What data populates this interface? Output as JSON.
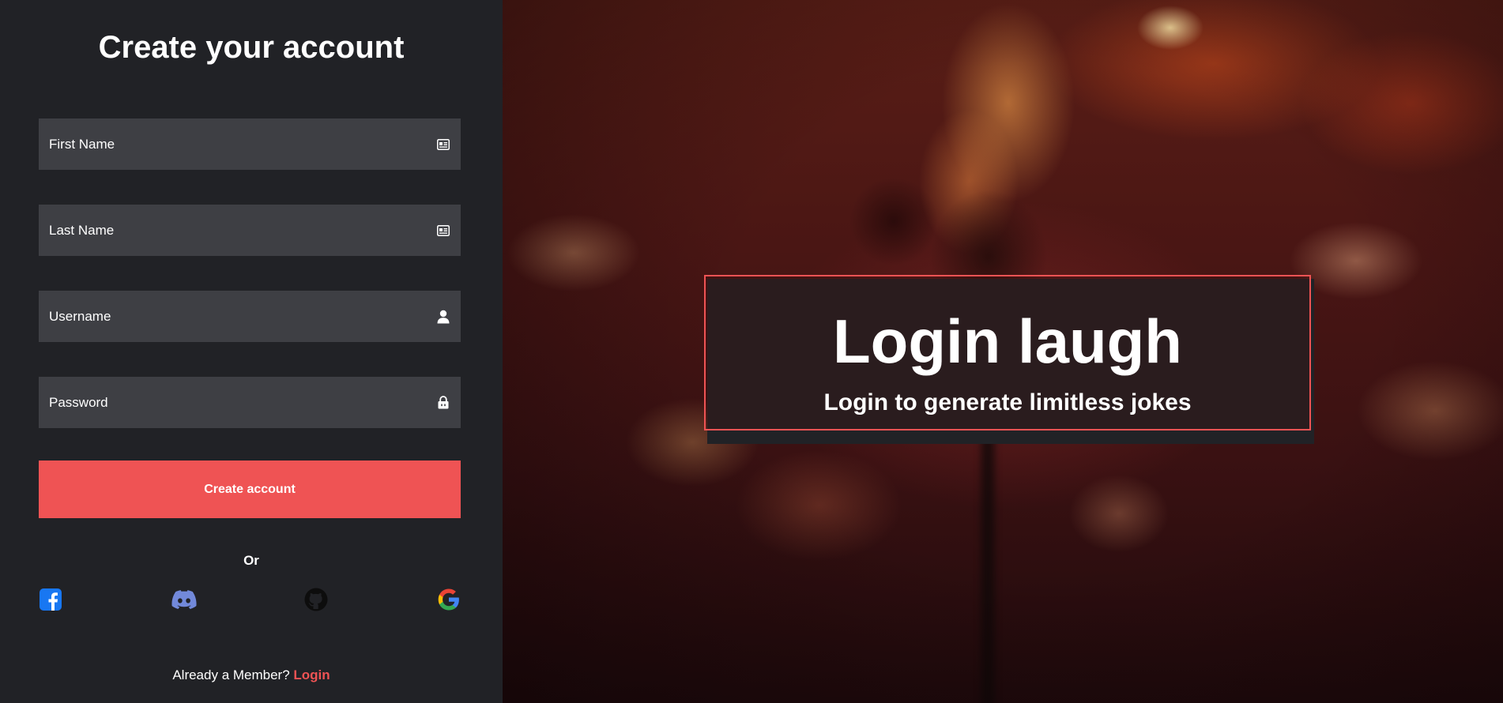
{
  "signup": {
    "title": "Create your account",
    "fields": {
      "first_name": {
        "placeholder": "First Name",
        "icon": "id-card-icon"
      },
      "last_name": {
        "placeholder": "Last Name",
        "icon": "id-card-icon"
      },
      "username": {
        "placeholder": "Username",
        "icon": "user-icon"
      },
      "password": {
        "placeholder": "Password",
        "icon": "lock-icon"
      }
    },
    "submit_label": "Create account",
    "or_label": "Or",
    "social": [
      {
        "name": "facebook",
        "icon": "facebook-icon",
        "color": "#1877f2"
      },
      {
        "name": "discord",
        "icon": "discord-icon",
        "color": "#7289da"
      },
      {
        "name": "github",
        "icon": "github-icon",
        "color": "#0d0d0d"
      },
      {
        "name": "google",
        "icon": "google-icon",
        "color": "#4285f4"
      }
    ],
    "member_prompt": "Already a Member?",
    "login_link": "Login"
  },
  "hero": {
    "title": "Login laugh",
    "subtitle": "Login to generate limitless jokes"
  },
  "colors": {
    "accent": "#ef5354",
    "panel": "#212226",
    "field": "#3e3f44"
  }
}
